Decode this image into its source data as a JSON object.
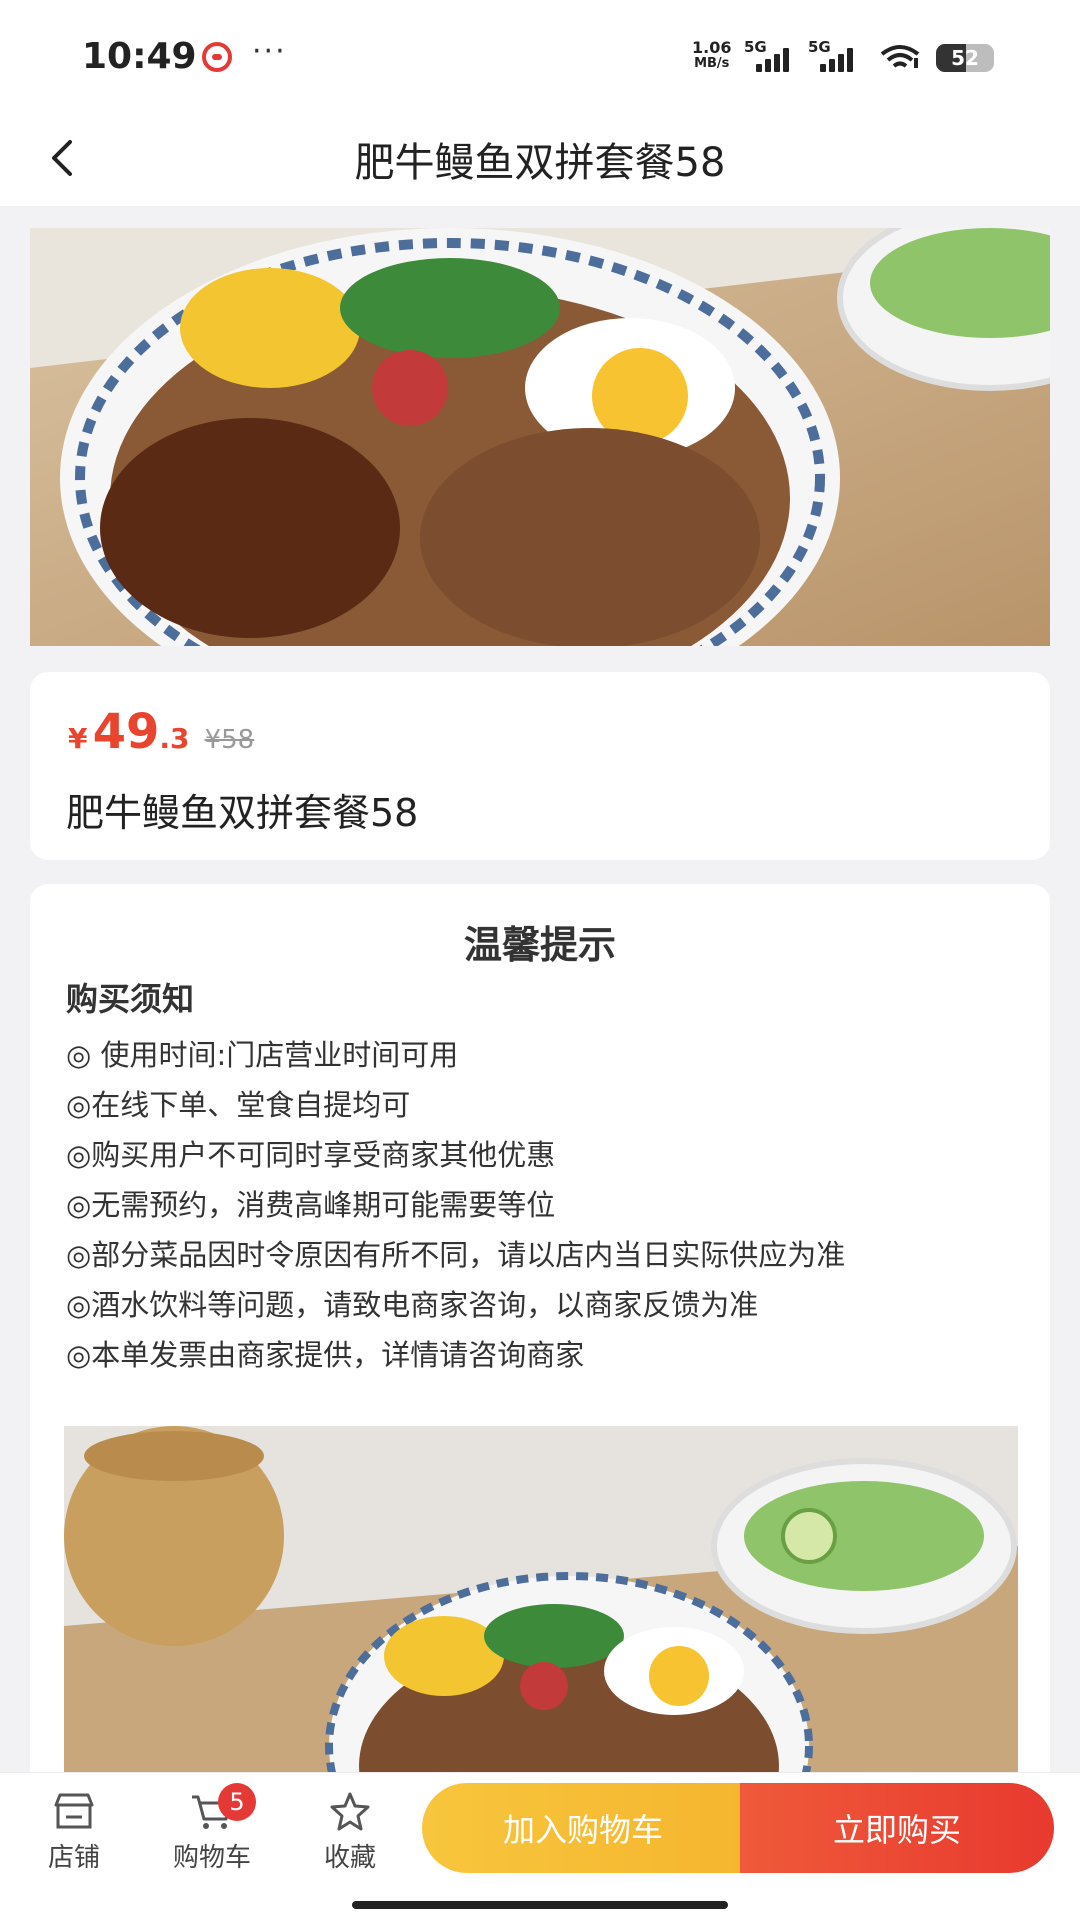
{
  "status": {
    "time": "10:49",
    "net_speed": "1.06",
    "net_unit": "MB/s",
    "sim1": "5G",
    "sim2": "5G",
    "battery": "52",
    "battery_level": 0.52
  },
  "nav": {
    "title": "肥牛鳗鱼双拼套餐58"
  },
  "product": {
    "currency": "¥",
    "price_int": "49",
    "price_dec": ".3",
    "original_price": "¥58",
    "name": "肥牛鳗鱼双拼套餐58"
  },
  "tips": {
    "title": "温馨提示",
    "subtitle": "购买须知",
    "items": [
      "◎ 使用时间:门店营业时间可用",
      "◎在线下单、堂食自提均可",
      "◎购买用户不可同时享受商家其他优惠",
      "◎无需预约，消费高峰期可能需要等位",
      "◎部分菜品因时令原因有所不同，请以店内当日实际供应为准",
      "◎酒水饮料等问题，请致电商家咨询，以商家反馈为准",
      "◎本单发票由商家提供，详情请咨询商家"
    ]
  },
  "bottom": {
    "store_label": "店铺",
    "cart_label": "购物车",
    "cart_count": "5",
    "fav_label": "收藏",
    "add_cart_label": "加入购物车",
    "buy_now_label": "立即购买"
  },
  "colors": {
    "price": "#e8442e",
    "add_cart": "#f5b52f",
    "buy_now": "#e8392f",
    "badge": "#e53935"
  }
}
